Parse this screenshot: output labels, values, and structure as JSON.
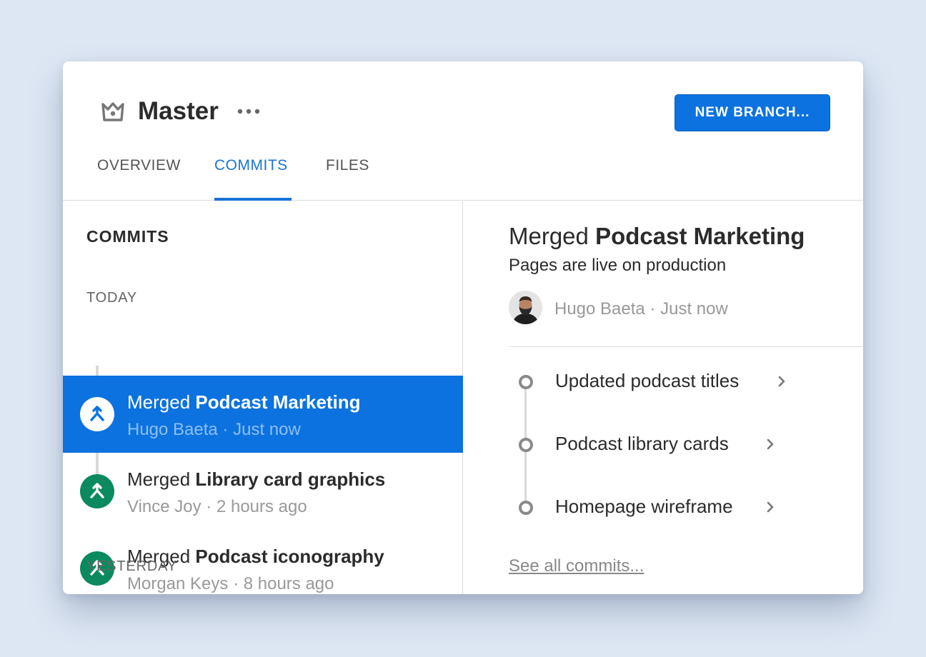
{
  "header": {
    "branch_name": "Master",
    "new_branch_label": "NEW BRANCH..."
  },
  "tabs": [
    {
      "label": "OVERVIEW",
      "active": false
    },
    {
      "label": "COMMITS",
      "active": true
    },
    {
      "label": "FILES",
      "active": false
    }
  ],
  "commits_panel": {
    "heading": "COMMITS",
    "groups": [
      "TODAY",
      "YESTERDAY"
    ],
    "items": [
      {
        "prefix": "Merged",
        "name": "Podcast Marketing",
        "author": "Hugo Baeta",
        "time": "Just now",
        "selected": true
      },
      {
        "prefix": "Merged",
        "name": "Library card graphics",
        "author": "Vince Joy",
        "time": "2 hours ago",
        "selected": false
      },
      {
        "prefix": "Merged",
        "name": "Podcast iconography",
        "author": "Morgan Keys",
        "time": "8 hours ago",
        "selected": false
      }
    ]
  },
  "detail": {
    "title_prefix": "Merged",
    "title_name": "Podcast Marketing",
    "subtitle": "Pages are live on production",
    "author": "Hugo Baeta",
    "time": "Just now",
    "sub_commits": [
      "Updated podcast titles",
      "Podcast library cards",
      "Homepage wireframe"
    ],
    "see_all_label": "See all commits..."
  },
  "colors": {
    "accent": "#0b72e0",
    "merge_green": "#0a8a5e",
    "background": "#dde7f4"
  },
  "icons": [
    "crown-icon",
    "more-icon",
    "merge-icon",
    "chevron-right-icon",
    "avatar"
  ]
}
